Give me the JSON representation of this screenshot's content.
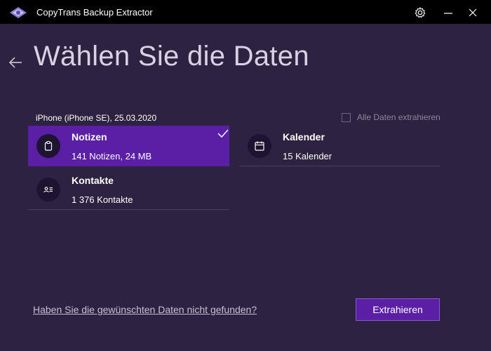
{
  "window": {
    "title": "CopyTrans Backup Extractor",
    "icons": [
      "app-logo-icon",
      "gear-icon",
      "minimize-icon",
      "close-icon"
    ]
  },
  "page": {
    "title": "Wählen Sie die Daten",
    "back_icon": "arrow-left-icon"
  },
  "device": {
    "label": "iPhone (iPhone SE), 25.03.2020"
  },
  "all_data": {
    "label": "Alle Daten extrahieren",
    "checked": false
  },
  "categories": [
    {
      "title": "Notizen",
      "subtitle": "141 Notizen, 24 MB",
      "icon": "clipboard-icon",
      "selected": true
    },
    {
      "title": "Kalender",
      "subtitle": "15 Kalender",
      "icon": "calendar-icon",
      "selected": false
    },
    {
      "title": "Kontakte",
      "subtitle": "1 376 Kontakte",
      "icon": "contact-card-icon",
      "selected": false
    }
  ],
  "footer": {
    "help_link": "Haben Sie die gewünschten Daten nicht gefunden?",
    "extract_label": "Extrahieren"
  },
  "colors": {
    "background": "#2d2341",
    "titlebar": "#000000",
    "accent": "#5b1fa6",
    "muted_text": "#8c859b"
  }
}
